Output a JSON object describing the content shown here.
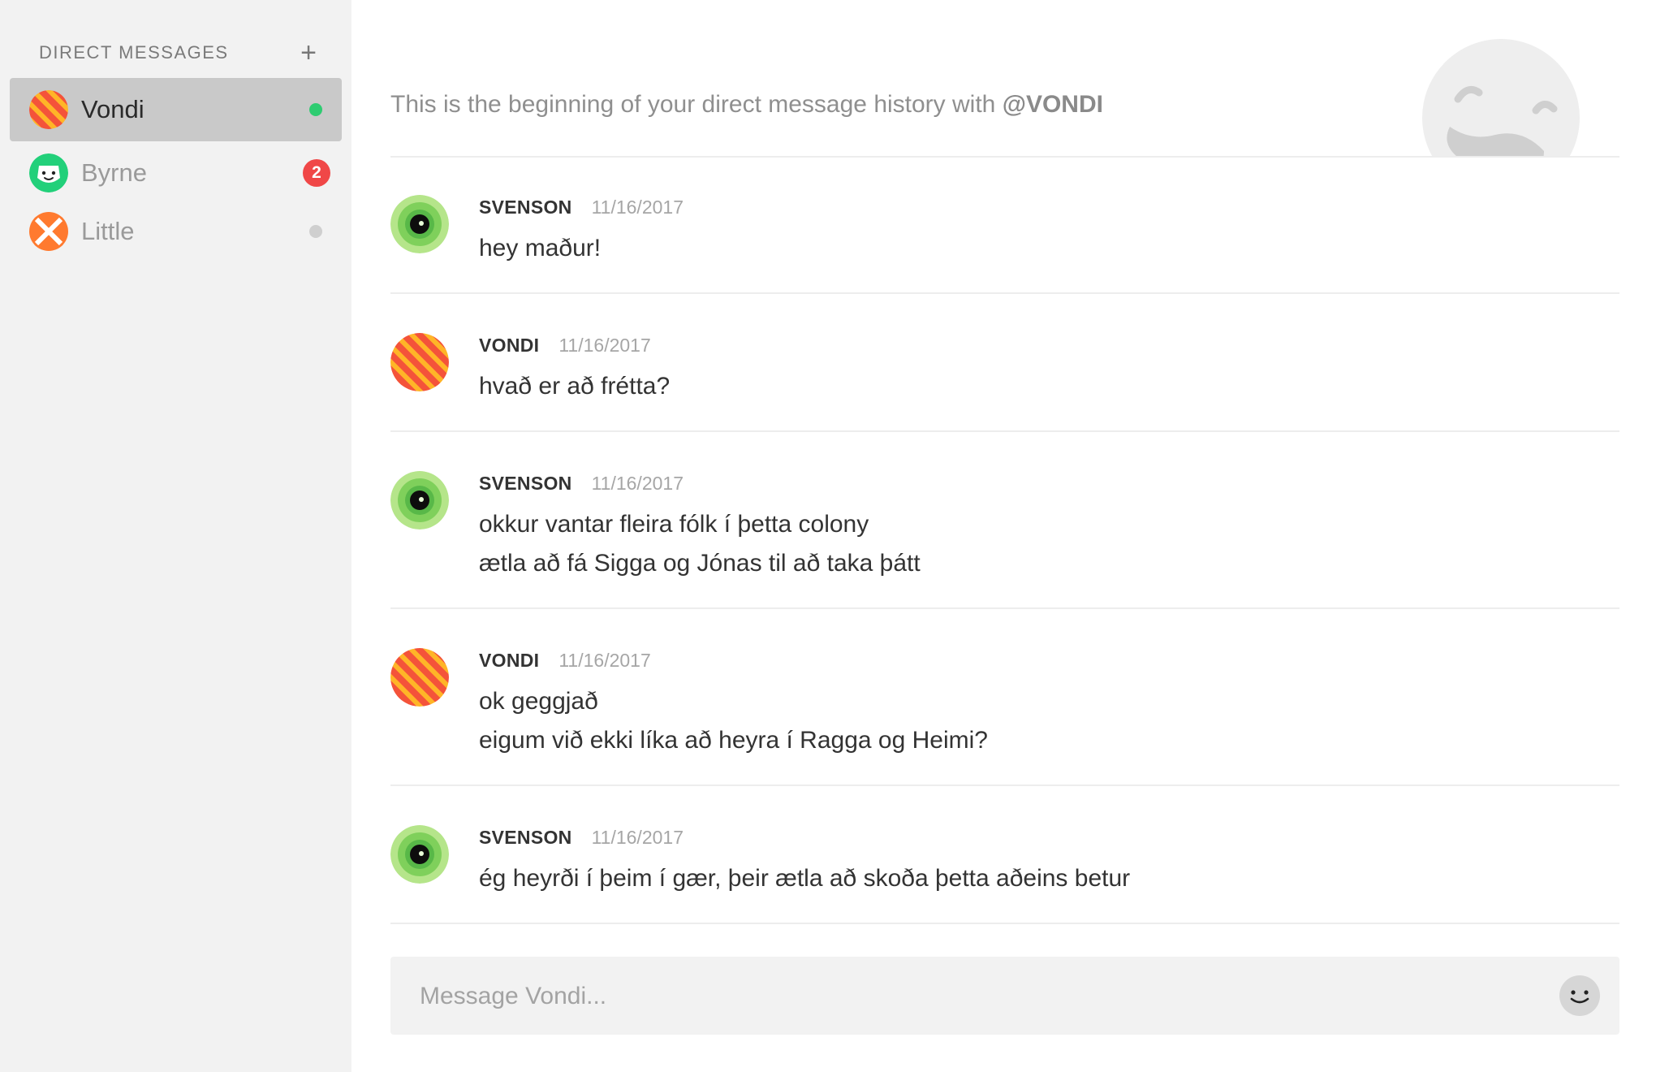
{
  "sidebar": {
    "header": "DIRECT MESSAGES",
    "add_icon": "plus-icon",
    "conversations": [
      {
        "name": "Vondi",
        "active": true,
        "status": "online",
        "status_color": "#2ecc71",
        "avatar": "striped-orange-avatar"
      },
      {
        "name": "Byrne",
        "active": false,
        "unread": "2",
        "badge_color": "#f04747",
        "avatar": "green-smiley-avatar"
      },
      {
        "name": "Little",
        "active": false,
        "status": "offline",
        "status_color": "#cfcfcf",
        "avatar": "orange-x-avatar"
      }
    ]
  },
  "chat": {
    "intro_prefix": "This is the beginning of your direct message history with ",
    "intro_user": "@VONDI",
    "hero_icon": "winking-face-icon",
    "messages": [
      {
        "author": "SVENSON",
        "time": "11/16/2017",
        "avatar": "green-eye-avatar",
        "lines": [
          "hey maður!"
        ]
      },
      {
        "author": "VONDI",
        "time": "11/16/2017",
        "avatar": "striped-orange-avatar",
        "lines": [
          "hvað er að frétta?"
        ]
      },
      {
        "author": "SVENSON",
        "time": "11/16/2017",
        "avatar": "green-eye-avatar",
        "lines": [
          "okkur vantar fleira fólk í þetta colony",
          "ætla að fá Sigga og Jónas til að taka þátt"
        ]
      },
      {
        "author": "VONDI",
        "time": "11/16/2017",
        "avatar": "striped-orange-avatar",
        "lines": [
          "ok geggjað",
          "eigum við ekki líka að heyra í Ragga og Heimi?"
        ]
      },
      {
        "author": "SVENSON",
        "time": "11/16/2017",
        "avatar": "green-eye-avatar",
        "lines": [
          "ég heyrði í þeim í gær, þeir ætla að skoða þetta aðeins betur"
        ]
      }
    ]
  },
  "composer": {
    "placeholder": "Message Vondi...",
    "emoji_icon": "smiley-icon"
  },
  "colors": {
    "sidebar_bg": "#f2f2f2",
    "active_item_bg": "#c9c9c9",
    "online": "#2ecc71",
    "badge": "#f04747"
  }
}
